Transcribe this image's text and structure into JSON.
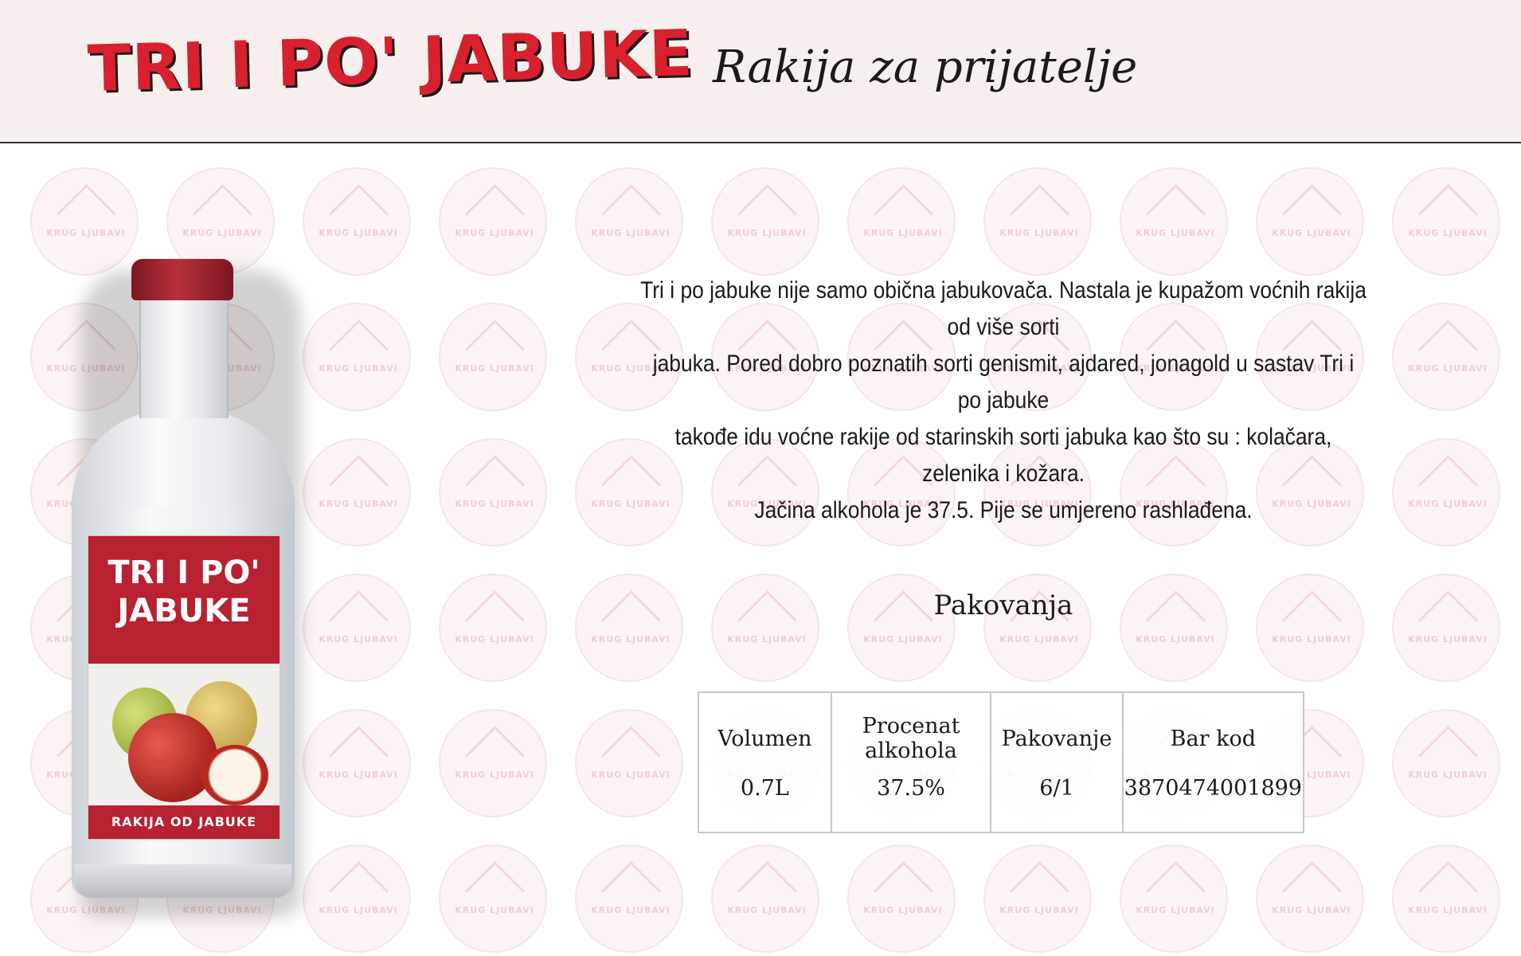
{
  "header": {
    "brand": "TRI I PO' JABUKE",
    "tagline": "Rakija za prijatelje"
  },
  "watermark": {
    "text": "KRUG LJUBAVI"
  },
  "bottle_label": {
    "name_line1": "TRI I PO'",
    "name_line2": "JABUKE",
    "subtitle": "RAKIJA OD JABUKE"
  },
  "description": {
    "lines": [
      "Tri i po jabuke nije samo obična jabukovača. Nastala je kupažom voćnih rakija od više sorti",
      "jabuka. Pored dobro poznatih sorti genismit, ajdared, jonagold u sastav Tri i po jabuke",
      "takođe idu voćne rakije od starinskih sorti jabuka kao što su : kolačara, zelenika i kožara.",
      "Jačina alkohola je 37.5.  Pije se umjereno rashlađena."
    ]
  },
  "packaging": {
    "title": "Pakovanja",
    "headers": [
      "Volumen",
      "Procenat alkohola",
      "Pakovanje",
      "Bar kod"
    ],
    "row": [
      "0.7L",
      "37.5%",
      "6/1",
      "3870474001899"
    ]
  },
  "colors": {
    "brand_red": "#d8202e",
    "header_bg": "#f7eeee",
    "label_red": "#b8212f"
  }
}
